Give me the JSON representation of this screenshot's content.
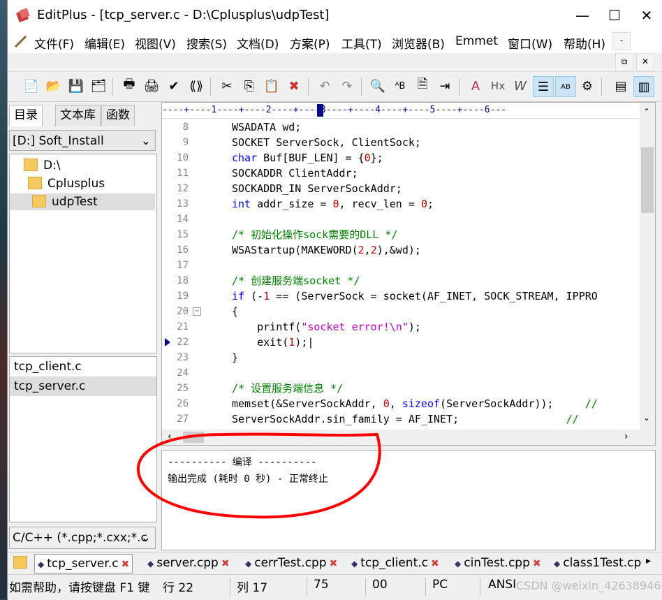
{
  "window": {
    "title": "EditPlus - [tcp_server.c - D:\\Cplusplus\\udpTest]"
  },
  "menu": [
    "文件(F)",
    "编辑(E)",
    "视图(V)",
    "搜索(S)",
    "文档(D)",
    "方案(P)",
    "工具(T)",
    "浏览器(B)",
    "Emmet",
    "窗口(W)",
    "帮助(H)"
  ],
  "left_panel": {
    "tabs": [
      "目录",
      "文本库",
      "函数"
    ],
    "drive": "[D:] Soft_Install",
    "tree": [
      "D:\\",
      "Cplusplus",
      "udpTest"
    ],
    "files": [
      "tcp_client.c",
      "tcp_server.c"
    ],
    "filter": "C/C++ (*.cpp;*.cxx;*.c"
  },
  "editor": {
    "ruler": "----+----1----+----2----+----3----+----4----+----5----+----6---",
    "line_numbers": [
      "8",
      "9",
      "10",
      "11",
      "12",
      "13",
      "14",
      "15",
      "16",
      "17",
      "18",
      "19",
      "20",
      "21",
      "22",
      "23",
      "24",
      "25",
      "26",
      "27"
    ]
  },
  "output": {
    "line1": "---------- 编译 ----------",
    "line2": "输出完成 (耗时 0 秒) - 正常终止"
  },
  "doc_tabs": [
    "tcp_server.c",
    "server.cpp",
    "cerrTest.cpp",
    "tcp_client.c",
    "cinTest.cpp",
    "class1Test.cp"
  ],
  "status": {
    "help": "如需帮助，请按键盘 F1 键",
    "line": "行 22",
    "col": "列 17",
    "chars": "75",
    "sel": "00",
    "eol": "PC",
    "enc": "ANSI",
    "watermark": "CSDN @weixin_42638946"
  },
  "colors": {
    "keyword": "#0000ff",
    "comment": "#008000",
    "string": "#c000c0",
    "annotation": "#ff0000"
  }
}
